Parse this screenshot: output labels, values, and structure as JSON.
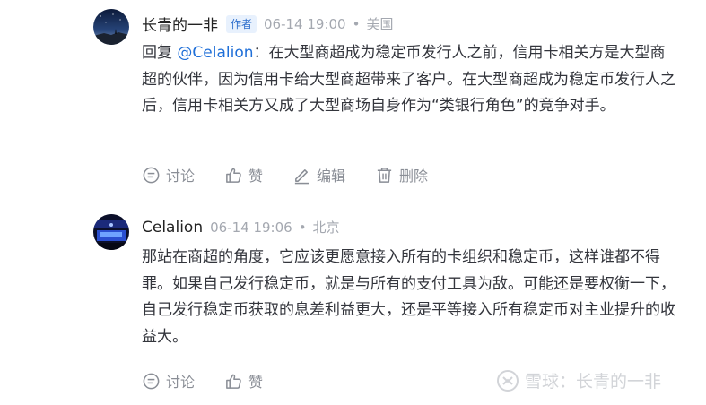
{
  "comments": [
    {
      "author": "长青的一非",
      "badge": "作者",
      "time": "06-14 19:00",
      "separator": "•",
      "location": "美国",
      "reply_prefix": "回复 ",
      "mention": "@Celalion",
      "reply_colon": "：",
      "text": "在大型商超成为稳定币发行人之前，信用卡相关方是大型商超的伙伴，因为信用卡给大型商超带来了客户。在大型商超成为稳定币发行人之后，信用卡相关方又成了大型商场自身作为“类银行角色”的竞争对手。",
      "actions": [
        "讨论",
        "赞",
        "编辑",
        "删除"
      ]
    },
    {
      "author": "Celalion",
      "time": "06-14 19:06",
      "separator": "•",
      "location": "北京",
      "text": "那站在商超的角度，它应该更愿意接入所有的卡组织和稳定币，这样谁都不得罪。如果自己发行稳定币，就是与所有的支付工具为敌。可能还是要权衡一下，自己发行稳定币获取的息差利益更大，还是平等接入所有稳定币对主业提升的收益大。",
      "actions": [
        "讨论",
        "赞"
      ]
    }
  ],
  "watermark": "雪球：长青的一非",
  "icons": [
    "comment-icon",
    "like-icon",
    "edit-icon",
    "delete-icon",
    "snowball-logo-icon"
  ]
}
